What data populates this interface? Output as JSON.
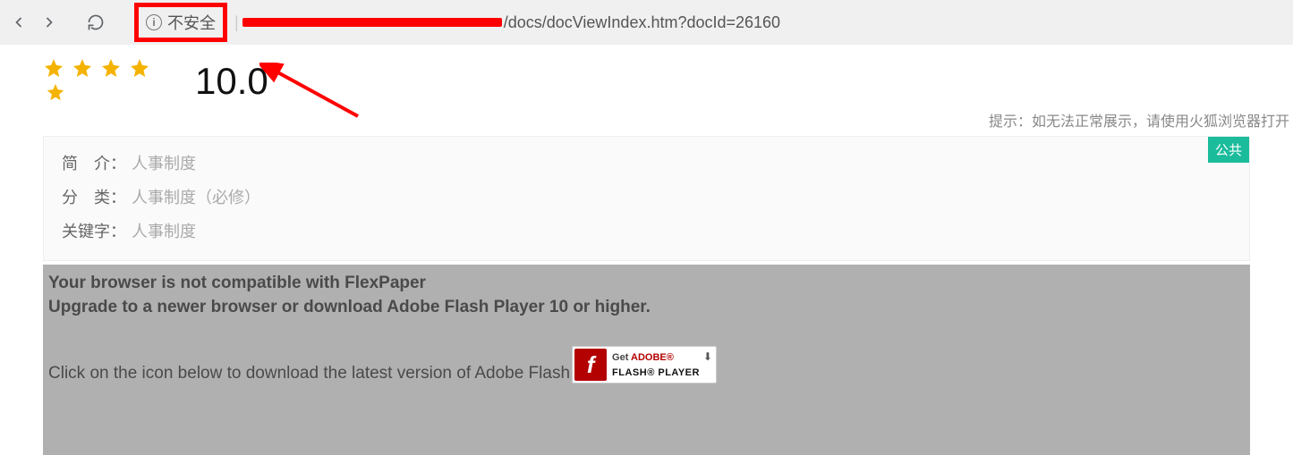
{
  "browser": {
    "security_label": "不安全",
    "url_suffix": "/docs/docViewIndex.htm?docId=26160"
  },
  "rating": {
    "score": "10.0"
  },
  "hint": "提示：如无法正常展示，请使用火狐浏览器打开",
  "meta": {
    "badge": "公共",
    "intro_label": "简　介：",
    "intro_value": "人事制度",
    "category_label": "分　类：",
    "category_value": "人事制度（必修）",
    "keywords_label": "关键字：",
    "keywords_value": "人事制度"
  },
  "flash": {
    "line1": "Your browser is not compatible with FlexPaper",
    "line2": "Upgrade to a newer browser or download Adobe Flash Player 10 or higher.",
    "click_text": "Click on the icon below to download the latest version of Adobe Flash",
    "get": "Get ",
    "adobe": "ADOBE®",
    "player": "FLASH® PLAYER"
  }
}
